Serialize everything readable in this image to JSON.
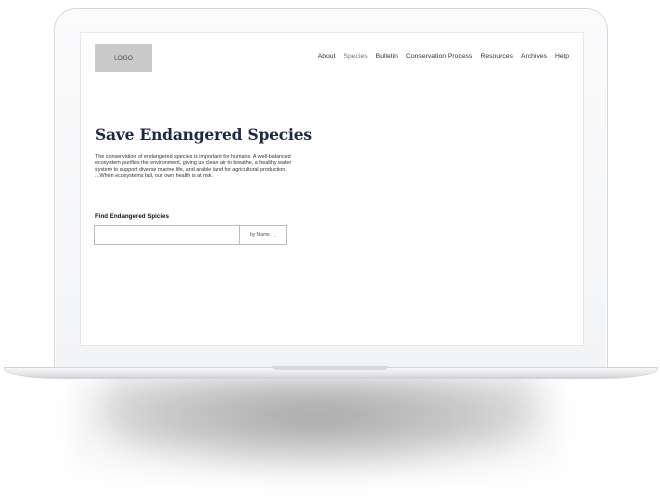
{
  "site": {
    "logo_label": "LOGO",
    "nav": [
      {
        "label": "About"
      },
      {
        "label": "Species",
        "active": true
      },
      {
        "label": "Bulletin"
      },
      {
        "label": "Conservation Process"
      },
      {
        "label": "Resources"
      },
      {
        "label": "Archives"
      },
      {
        "label": "Help"
      }
    ]
  },
  "hero": {
    "title": "Save Endangered Species",
    "body": "The conservation of endangered species is important for humans. A well-balanced ecosystem purifies the environment, giving us clean air to breathe, a healthy water system to support diverse marine life, and arable land for agricultural production. ...When ecosystems fail, our own health is at risk."
  },
  "search": {
    "label": "Find Endangered Spicies",
    "input_value": "",
    "input_placeholder": "",
    "filter_selected": "by Name"
  },
  "colors": {
    "title": "#1c2848",
    "logo_bg": "#c9c9c9",
    "nav_active": "#777777"
  }
}
